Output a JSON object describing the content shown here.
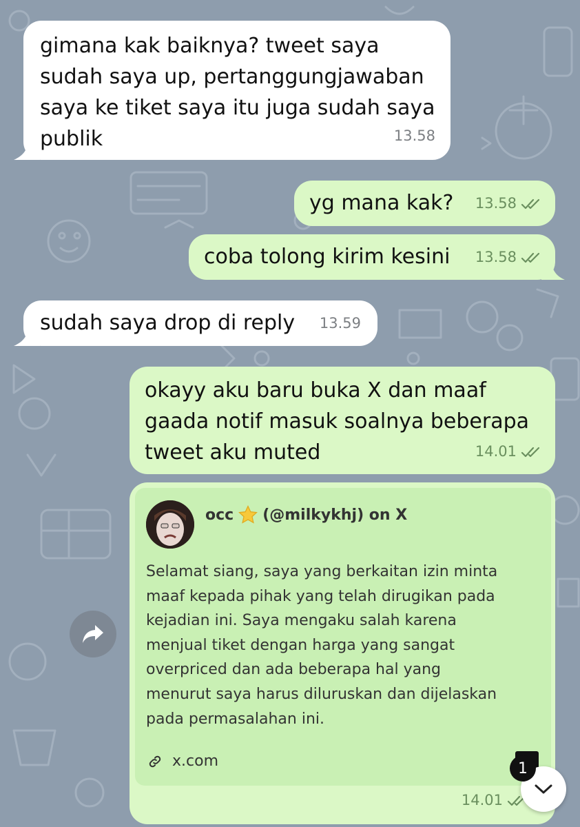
{
  "messages": [
    {
      "id": "m1",
      "direction": "incoming",
      "lines": [
        "gimana kak baiknya? tweet saya",
        "sudah saya up, pertanggungjawaban",
        "saya ke tiket saya itu juga sudah saya",
        "publik"
      ],
      "time": "13.58"
    },
    {
      "id": "m2",
      "direction": "outgoing",
      "lines": [
        "yg mana kak?"
      ],
      "time": "13.58",
      "status": "read"
    },
    {
      "id": "m3",
      "direction": "outgoing",
      "lines": [
        "coba tolong kirim kesini"
      ],
      "time": "13.58",
      "status": "read"
    },
    {
      "id": "m4",
      "direction": "incoming",
      "lines": [
        "sudah saya drop di reply"
      ],
      "time": "13.59"
    },
    {
      "id": "m5",
      "direction": "outgoing",
      "lines": [
        "okayy aku baru buka X dan maaf",
        "gaada notif masuk soalnya beberapa",
        "tweet aku muted"
      ],
      "time": "14.01",
      "status": "read"
    },
    {
      "id": "m6",
      "direction": "outgoing",
      "time": "14.01",
      "status": "read",
      "link_preview": {
        "title_name": "occ",
        "title_handle": "(@milkykhj) on X",
        "title_emoji": "star",
        "body": "Selamat siang, saya yang berkaitan izin minta\nmaaf kepada  pihak yang telah dirugikan pada\nkejadian ini. Saya mengaku salah karena\nmenjual tiket dengan harga yang sangat\noverpriced dan ada beberapa hal yang\nmenurut saya harus diluruskan dan dijelaskan\npada permasalahan ini.",
        "domain": "x.com"
      }
    }
  ],
  "unread_badge": "1",
  "icons": {
    "forward": "forward-arrow-icon",
    "scroll_down": "chevron-down-icon",
    "link": "link-icon",
    "read_status": "double-check-icon"
  },
  "colors": {
    "background": "#8e9dad",
    "incoming_bubble": "#ffffff",
    "outgoing_bubble": "#dbf8c6",
    "preview_card": "#c9f0b4"
  }
}
